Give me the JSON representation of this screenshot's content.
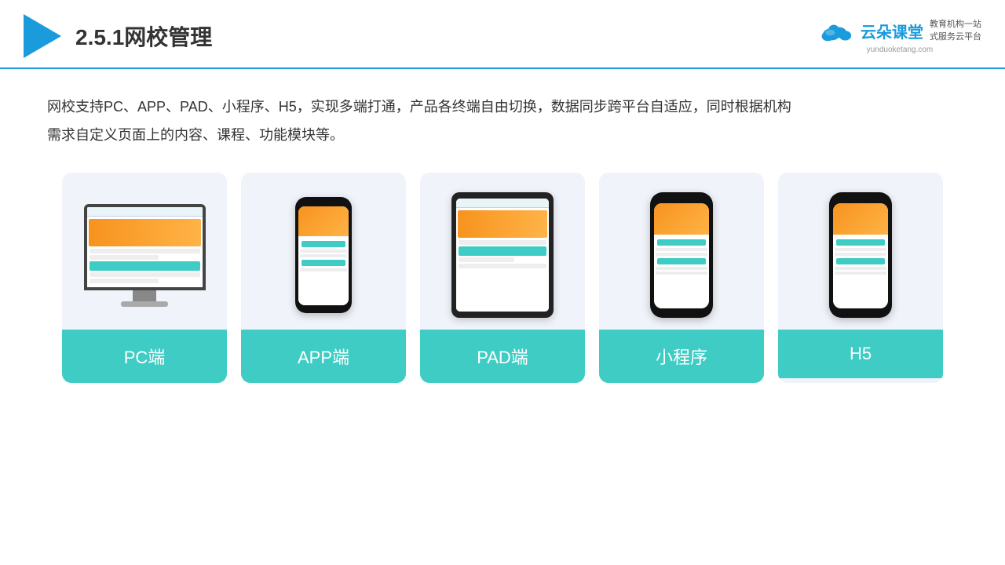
{
  "header": {
    "title": "2.5.1网校管理",
    "brand": {
      "name": "云朵课堂",
      "url": "yunduoketang.com",
      "tagline": "教育机构一站\n式服务云平台"
    }
  },
  "description": "网校支持PC、APP、PAD、小程序、H5，实现多端打通，产品各终端自由切换，数据同步跨平台自适应，同时根据机构\n需求自定义页面上的内容、课程、功能模块等。",
  "cards": [
    {
      "id": "pc",
      "label": "PC端"
    },
    {
      "id": "app",
      "label": "APP端"
    },
    {
      "id": "pad",
      "label": "PAD端"
    },
    {
      "id": "miniprogram",
      "label": "小程序"
    },
    {
      "id": "h5",
      "label": "H5"
    }
  ],
  "colors": {
    "accent": "#1a9bdc",
    "teal": "#3eccc4",
    "orange": "#f7931e"
  }
}
